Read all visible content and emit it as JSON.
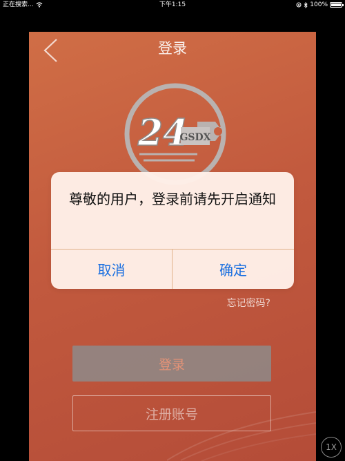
{
  "status_bar": {
    "carrier": "正在搜索...",
    "wifi_icon": "wifi-icon",
    "time": "下午1:15",
    "lock_icon": "orientation-lock-icon",
    "bluetooth_icon": "bluetooth-icon",
    "battery_percent": "100%",
    "battery_level": 1.0
  },
  "nav": {
    "back_icon": "chevron-left-icon",
    "title": "登录"
  },
  "logo": {
    "number": "24",
    "text": "GSDX",
    "icon": "wrench-logo-icon"
  },
  "forgot_password": "忘记密码?",
  "login_button": "登录",
  "register_button": "注册账号",
  "alert": {
    "message": "尊敬的用户，登录前请先开启通知",
    "cancel": "取消",
    "confirm": "确定"
  },
  "zoom_badge": "1X",
  "colors": {
    "background_top": "#d06e46",
    "background_bottom": "#b44c38",
    "alert_button": "#1a6fe0",
    "login_button_text": "#e49377"
  }
}
